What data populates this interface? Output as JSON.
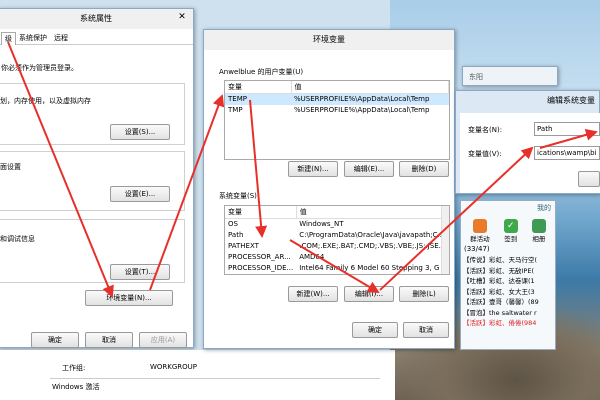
{
  "sys_props": {
    "title": "系统属性",
    "tabs": [
      "级",
      "系统保护",
      "远程"
    ],
    "admin_note": "你必须作为管理员登录。",
    "perf_desc": "划，内存使用，以及虚拟内存",
    "btn_settings1": "设置(S)...",
    "profile_desc": "面设置",
    "btn_settings2": "设置(E)...",
    "startup_desc": "和调试信息",
    "btn_settings3": "设置(T)...",
    "btn_env": "环境变量(N)...",
    "btn_ok": "确定",
    "btn_cancel": "取消",
    "btn_apply": "应用(A)",
    "workgroup_label": "工作组:",
    "workgroup_value": "WORKGROUP",
    "windows_activation": "Windows 激活"
  },
  "env_vars": {
    "title": "环境变量",
    "user_group_label": "Anwelblue 的用户变量(U)",
    "col_var": "变量",
    "col_val": "值",
    "user_vars": [
      {
        "name": "TEMP",
        "value": "%USERPROFILE%\\AppData\\Local\\Temp"
      },
      {
        "name": "TMP",
        "value": "%USERPROFILE%\\AppData\\Local\\Temp"
      }
    ],
    "btn_user_new": "新建(N)...",
    "btn_user_edit": "编辑(E)...",
    "btn_user_delete": "删除(D)",
    "sys_group_label": "系统变量(S)",
    "sys_vars": [
      {
        "name": "OS",
        "value": "Windows_NT"
      },
      {
        "name": "Path",
        "value": "C:\\ProgramData\\Oracle\\Java\\javapath;C..."
      },
      {
        "name": "PATHEXT",
        "value": ".COM;.EXE;.BAT;.CMD;.VBS;.VBE;.JS;.JSE..."
      },
      {
        "name": "PROCESSOR_AR...",
        "value": "AMD64"
      },
      {
        "name": "PROCESSOR_IDE...",
        "value": "Intel64 Family 6 Model 60 Stepping 3, G"
      }
    ],
    "btn_sys_new": "新建(W)...",
    "btn_sys_edit": "编辑(I)...",
    "btn_sys_delete": "删除(L)",
    "btn_ok": "确定",
    "btn_cancel": "取消"
  },
  "edit_var": {
    "title": "编辑系统变量",
    "name_label": "变量名(N):",
    "name_value": "Path",
    "value_label": "变量值(V):",
    "value_value": "ications\\wamp\\bin\\"
  },
  "chat": {
    "header": "我的",
    "icons": [
      {
        "label": "群活动",
        "icon": "chat-bubble-icon"
      },
      {
        "label": "签到",
        "icon": "checkin-icon"
      },
      {
        "label": "相册",
        "icon": "album-icon"
      }
    ],
    "count": "(33/47)",
    "members": [
      "【传说】彩虹、天马行空(",
      "【活跃】彩虹、无敌IPE(",
      "【吐槽】彩虹、达卷课(1",
      "【活跃】彩虹、女大王(3",
      "【活跃】壹哥（馨馨）(89",
      "【冒泡】the saltwater r",
      "【活跃】彩虹、倦倦(984"
    ],
    "bottom_label": "东阳"
  },
  "colors": {
    "arrow": "#e8302a",
    "selection": "#cde8ff"
  }
}
